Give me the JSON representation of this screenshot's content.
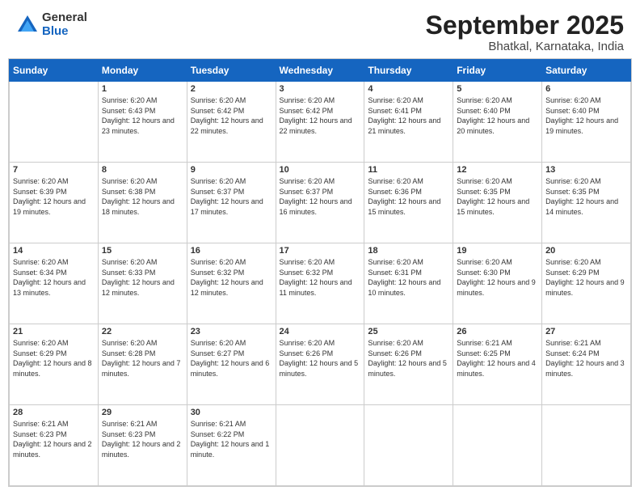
{
  "logo": {
    "general": "General",
    "blue": "Blue"
  },
  "title": {
    "month": "September 2025",
    "location": "Bhatkal, Karnataka, India"
  },
  "days_header": [
    "Sunday",
    "Monday",
    "Tuesday",
    "Wednesday",
    "Thursday",
    "Friday",
    "Saturday"
  ],
  "weeks": [
    [
      {
        "day": "",
        "sunrise": "",
        "sunset": "",
        "daylight": ""
      },
      {
        "day": "1",
        "sunrise": "Sunrise: 6:20 AM",
        "sunset": "Sunset: 6:43 PM",
        "daylight": "Daylight: 12 hours and 23 minutes."
      },
      {
        "day": "2",
        "sunrise": "Sunrise: 6:20 AM",
        "sunset": "Sunset: 6:42 PM",
        "daylight": "Daylight: 12 hours and 22 minutes."
      },
      {
        "day": "3",
        "sunrise": "Sunrise: 6:20 AM",
        "sunset": "Sunset: 6:42 PM",
        "daylight": "Daylight: 12 hours and 22 minutes."
      },
      {
        "day": "4",
        "sunrise": "Sunrise: 6:20 AM",
        "sunset": "Sunset: 6:41 PM",
        "daylight": "Daylight: 12 hours and 21 minutes."
      },
      {
        "day": "5",
        "sunrise": "Sunrise: 6:20 AM",
        "sunset": "Sunset: 6:40 PM",
        "daylight": "Daylight: 12 hours and 20 minutes."
      },
      {
        "day": "6",
        "sunrise": "Sunrise: 6:20 AM",
        "sunset": "Sunset: 6:40 PM",
        "daylight": "Daylight: 12 hours and 19 minutes."
      }
    ],
    [
      {
        "day": "7",
        "sunrise": "Sunrise: 6:20 AM",
        "sunset": "Sunset: 6:39 PM",
        "daylight": "Daylight: 12 hours and 19 minutes."
      },
      {
        "day": "8",
        "sunrise": "Sunrise: 6:20 AM",
        "sunset": "Sunset: 6:38 PM",
        "daylight": "Daylight: 12 hours and 18 minutes."
      },
      {
        "day": "9",
        "sunrise": "Sunrise: 6:20 AM",
        "sunset": "Sunset: 6:37 PM",
        "daylight": "Daylight: 12 hours and 17 minutes."
      },
      {
        "day": "10",
        "sunrise": "Sunrise: 6:20 AM",
        "sunset": "Sunset: 6:37 PM",
        "daylight": "Daylight: 12 hours and 16 minutes."
      },
      {
        "day": "11",
        "sunrise": "Sunrise: 6:20 AM",
        "sunset": "Sunset: 6:36 PM",
        "daylight": "Daylight: 12 hours and 15 minutes."
      },
      {
        "day": "12",
        "sunrise": "Sunrise: 6:20 AM",
        "sunset": "Sunset: 6:35 PM",
        "daylight": "Daylight: 12 hours and 15 minutes."
      },
      {
        "day": "13",
        "sunrise": "Sunrise: 6:20 AM",
        "sunset": "Sunset: 6:35 PM",
        "daylight": "Daylight: 12 hours and 14 minutes."
      }
    ],
    [
      {
        "day": "14",
        "sunrise": "Sunrise: 6:20 AM",
        "sunset": "Sunset: 6:34 PM",
        "daylight": "Daylight: 12 hours and 13 minutes."
      },
      {
        "day": "15",
        "sunrise": "Sunrise: 6:20 AM",
        "sunset": "Sunset: 6:33 PM",
        "daylight": "Daylight: 12 hours and 12 minutes."
      },
      {
        "day": "16",
        "sunrise": "Sunrise: 6:20 AM",
        "sunset": "Sunset: 6:32 PM",
        "daylight": "Daylight: 12 hours and 12 minutes."
      },
      {
        "day": "17",
        "sunrise": "Sunrise: 6:20 AM",
        "sunset": "Sunset: 6:32 PM",
        "daylight": "Daylight: 12 hours and 11 minutes."
      },
      {
        "day": "18",
        "sunrise": "Sunrise: 6:20 AM",
        "sunset": "Sunset: 6:31 PM",
        "daylight": "Daylight: 12 hours and 10 minutes."
      },
      {
        "day": "19",
        "sunrise": "Sunrise: 6:20 AM",
        "sunset": "Sunset: 6:30 PM",
        "daylight": "Daylight: 12 hours and 9 minutes."
      },
      {
        "day": "20",
        "sunrise": "Sunrise: 6:20 AM",
        "sunset": "Sunset: 6:29 PM",
        "daylight": "Daylight: 12 hours and 9 minutes."
      }
    ],
    [
      {
        "day": "21",
        "sunrise": "Sunrise: 6:20 AM",
        "sunset": "Sunset: 6:29 PM",
        "daylight": "Daylight: 12 hours and 8 minutes."
      },
      {
        "day": "22",
        "sunrise": "Sunrise: 6:20 AM",
        "sunset": "Sunset: 6:28 PM",
        "daylight": "Daylight: 12 hours and 7 minutes."
      },
      {
        "day": "23",
        "sunrise": "Sunrise: 6:20 AM",
        "sunset": "Sunset: 6:27 PM",
        "daylight": "Daylight: 12 hours and 6 minutes."
      },
      {
        "day": "24",
        "sunrise": "Sunrise: 6:20 AM",
        "sunset": "Sunset: 6:26 PM",
        "daylight": "Daylight: 12 hours and 5 minutes."
      },
      {
        "day": "25",
        "sunrise": "Sunrise: 6:20 AM",
        "sunset": "Sunset: 6:26 PM",
        "daylight": "Daylight: 12 hours and 5 minutes."
      },
      {
        "day": "26",
        "sunrise": "Sunrise: 6:21 AM",
        "sunset": "Sunset: 6:25 PM",
        "daylight": "Daylight: 12 hours and 4 minutes."
      },
      {
        "day": "27",
        "sunrise": "Sunrise: 6:21 AM",
        "sunset": "Sunset: 6:24 PM",
        "daylight": "Daylight: 12 hours and 3 minutes."
      }
    ],
    [
      {
        "day": "28",
        "sunrise": "Sunrise: 6:21 AM",
        "sunset": "Sunset: 6:23 PM",
        "daylight": "Daylight: 12 hours and 2 minutes."
      },
      {
        "day": "29",
        "sunrise": "Sunrise: 6:21 AM",
        "sunset": "Sunset: 6:23 PM",
        "daylight": "Daylight: 12 hours and 2 minutes."
      },
      {
        "day": "30",
        "sunrise": "Sunrise: 6:21 AM",
        "sunset": "Sunset: 6:22 PM",
        "daylight": "Daylight: 12 hours and 1 minute."
      },
      {
        "day": "",
        "sunrise": "",
        "sunset": "",
        "daylight": ""
      },
      {
        "day": "",
        "sunrise": "",
        "sunset": "",
        "daylight": ""
      },
      {
        "day": "",
        "sunrise": "",
        "sunset": "",
        "daylight": ""
      },
      {
        "day": "",
        "sunrise": "",
        "sunset": "",
        "daylight": ""
      }
    ]
  ]
}
